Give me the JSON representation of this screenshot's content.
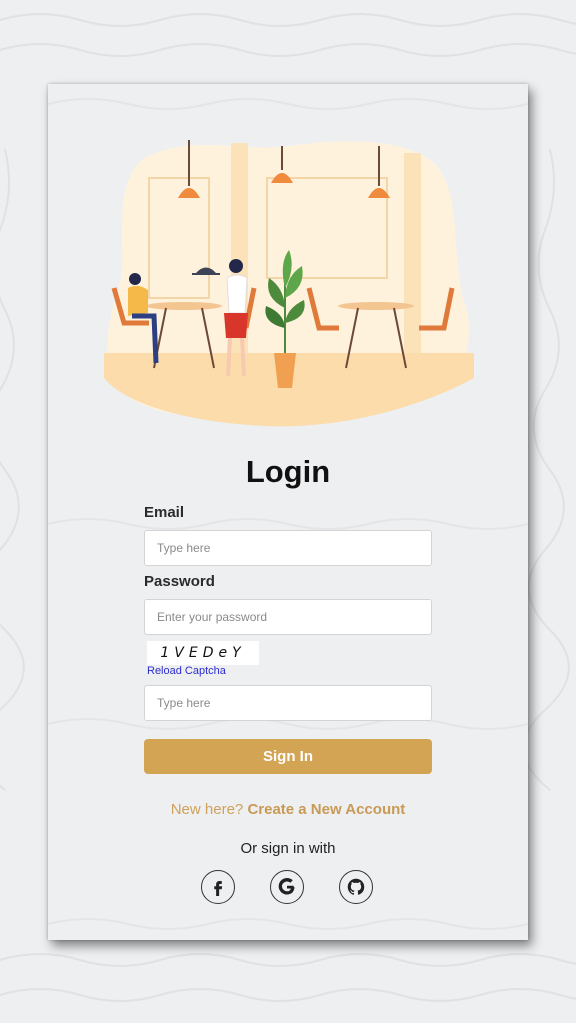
{
  "login": {
    "title": "Login",
    "email_label": "Email",
    "email_placeholder": "Type here",
    "password_label": "Password",
    "password_placeholder": "Enter your password",
    "captcha_text": "1VEDeY",
    "reload_captcha": "Reload Captcha",
    "captcha_placeholder": "Type here",
    "signin_label": "Sign In",
    "new_here": "New here?",
    "create_account": "Create a New Account",
    "or_sign_in": "Or sign in with"
  },
  "social": [
    "facebook-icon",
    "google-icon",
    "github-icon"
  ],
  "colors": {
    "accent": "#d4a455",
    "link": "#2d2dcf",
    "background": "#eeeff1"
  }
}
